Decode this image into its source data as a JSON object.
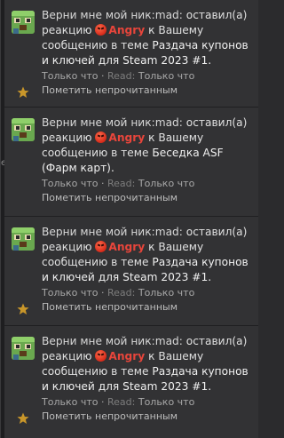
{
  "alerts": [
    {
      "user": "Верни мне мой ник:mad:",
      "action_pre": "оставил(а) реакцию",
      "reaction": "Angry",
      "action_post": "к Вашему сообщению в теме",
      "thread": "Раздача купонов и ключей для Steam 2023 #1.",
      "time": "Только что",
      "sep": "·",
      "read_label": "Read:",
      "read_time": "Только что",
      "mark_unread": "Пометить непрочитанным"
    },
    {
      "user": "Верни мне мой ник:mad:",
      "action_pre": "оставил(а) реакцию",
      "reaction": "Angry",
      "action_post": "к Вашему сообщению в теме",
      "thread": "Беседка ASF (Фарм карт).",
      "time": "Только что",
      "sep": "·",
      "read_label": "Read:",
      "read_time": "Только что",
      "mark_unread": "Пометить непрочитанным"
    },
    {
      "user": "Верни мне мой ник:mad:",
      "action_pre": "оставил(а) реакцию",
      "reaction": "Angry",
      "action_post": "к Вашему сообщению в теме",
      "thread": "Раздача купонов и ключей для Steam 2023 #1.",
      "time": "Только что",
      "sep": "·",
      "read_label": "Read:",
      "read_time": "Только что",
      "mark_unread": "Пометить непрочитанным"
    },
    {
      "user": "Верни мне мой ник:mad:",
      "action_pre": "оставил(а) реакцию",
      "reaction": "Angry",
      "action_post": "к Вашему сообщению в теме",
      "thread": "Раздача купонов и ключей для Steam 2023 #1.",
      "time": "Только что",
      "sep": "·",
      "read_label": "Read:",
      "read_time": "Только что",
      "mark_unread": "Пометить непрочитанным"
    }
  ],
  "edge_glyph": "e",
  "colors": {
    "reaction": "#e8453b",
    "background": "#323234",
    "star": "#c8962a"
  },
  "icons": {
    "avatar": "minecraft-creeper-avatar-icon",
    "star": "star-icon",
    "reaction": "angry-face-icon"
  }
}
